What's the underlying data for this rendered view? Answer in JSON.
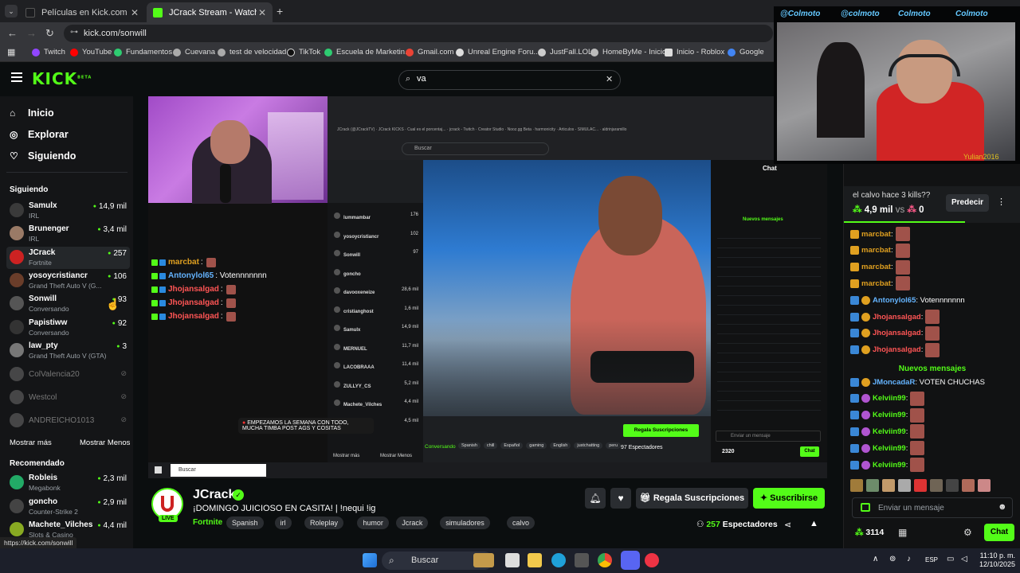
{
  "browser": {
    "tabs": [
      {
        "title": "Películas en Kick.com",
        "active": false
      },
      {
        "title": "JCrack Stream - Watch Live on Kick",
        "active": true
      }
    ],
    "url": "kick.com/sonwill",
    "bookmarks": [
      "Twitch",
      "YouTube",
      "Fundamentos",
      "Cuevana",
      "test de velocidad",
      "TikTok",
      "Escuela de Marketin...",
      "Gmail.com",
      "Unreal Engine Foru...",
      "JustFall.LOL",
      "HomeByMe - Inicio",
      "Inicio - Roblox",
      "Google"
    ],
    "status_url": "https://kick.com/sonwill"
  },
  "header": {
    "logo": "KICK",
    "logo_sup": "BETA",
    "search_value": "va"
  },
  "sidebar": {
    "nav": [
      {
        "label": "Inicio",
        "icon": "home-icon"
      },
      {
        "label": "Explorar",
        "icon": "compass-icon"
      },
      {
        "label": "Siguiendo",
        "icon": "heart-icon"
      }
    ],
    "following_title": "Siguiendo",
    "following": [
      {
        "name": "Samulx",
        "sub": "IRL",
        "viewers": "14,9 mil",
        "color": "#3a3a3a"
      },
      {
        "name": "Brunenger",
        "sub": "IRL",
        "viewers": "3,4 mil",
        "color": "#9a7a66"
      },
      {
        "name": "JCrack",
        "sub": "Fortnite",
        "viewers": "257",
        "color": "#c22",
        "selected": true
      },
      {
        "name": "yosoycristiancr",
        "sub": "Grand Theft Auto V (G...",
        "viewers": "106",
        "color": "#6a3d2a"
      },
      {
        "name": "Sonwill",
        "sub": "Conversando",
        "viewers": "93",
        "color": "#555"
      },
      {
        "name": "Papistiww",
        "sub": "Conversando",
        "viewers": "92",
        "color": "#333"
      },
      {
        "name": "law_pty",
        "sub": "Grand Theft Auto V (GTA)",
        "viewers": "3",
        "color": "#777"
      }
    ],
    "offline": [
      {
        "name": "ColValencia20"
      },
      {
        "name": "Westcol"
      },
      {
        "name": "ANDREICHO1013"
      }
    ],
    "show_more": "Mostrar más",
    "show_less": "Mostrar Menos",
    "recommended_title": "Recomendado",
    "recommended": [
      {
        "name": "Robleis",
        "sub": "Megabonk",
        "viewers": "2,3 mil",
        "color": "#2a6"
      },
      {
        "name": "goncho",
        "sub": "Counter-Strike 2",
        "viewers": "2,9 mil",
        "color": "#444"
      },
      {
        "name": "Machete_Vilches",
        "sub": "Slots & Casino",
        "viewers": "4,4 mil",
        "color": "#8a2"
      }
    ]
  },
  "player": {
    "inner_search": "Buscar",
    "inner_chat_title": "Chat",
    "inner_new_messages": "Nuevos mensajes",
    "inner_viewers": "97 Espectadores",
    "inner_gift": "Regala Suscripciones",
    "inner_chat_placeholder": "Enviar un mensaje",
    "inner_chat_btn": "Chat",
    "inner_points": "2320",
    "inner_tags": [
      "Spanish",
      "chill",
      "Español",
      "gaming",
      "English",
      "justchatting",
      "peru"
    ],
    "inner_category": "Conversando",
    "bubble_text": "EMPEZAMOS LA SEMANA CON TODO, MUCHA TIMBA POST AGS Y COSITAS",
    "overlay_chat": [
      {
        "user": "marcbat",
        "text": ":",
        "color": "#e0a020"
      },
      {
        "user": "Antonylol65",
        "text": ": Votennnnnnn",
        "color": "#64b4ff"
      },
      {
        "user": "Jhojansalgad",
        "text": ":",
        "color": "#ff5555"
      },
      {
        "user": "Jhojansalgad",
        "text": ":",
        "color": "#ff5555"
      },
      {
        "user": "Jhojansalgad",
        "text": ":",
        "color": "#ff5555"
      }
    ],
    "inner_sidebar": [
      {
        "name": "lummambar",
        "v": "176"
      },
      {
        "name": "yosoycristiancr",
        "v": "102"
      },
      {
        "name": "Sonwill",
        "v": "97"
      },
      {
        "name": "goncho",
        "v": ""
      },
      {
        "name": "davooxeneize",
        "v": "28,6 mil"
      },
      {
        "name": "cristianghost",
        "v": "1,6 mil"
      },
      {
        "name": "Samulx",
        "v": "14,9 mil"
      },
      {
        "name": "MERNUEL",
        "v": "11,7 mil"
      },
      {
        "name": "LACOBRAAA",
        "v": "11,4 mil"
      },
      {
        "name": "ZULLYY_CS",
        "v": "5,2 mil"
      },
      {
        "name": "Machete_Vilches",
        "v": "4,4 mil"
      },
      {
        "name": "SoyPan",
        "v": "4,5 mil"
      }
    ],
    "inner_show_more": "Mostrar más",
    "inner_show_less": "Mostrar Menos",
    "inner_taskbar_search": "Buscar"
  },
  "camtop": {
    "labels": [
      "@Colmoto",
      "@colmoto",
      "Colmoto",
      "Colmoto"
    ]
  },
  "stream": {
    "channel": "JCrack",
    "live_label": "LIVE",
    "title": "¡DOMINGO JUICIOSO EN CASITA! | !nequi !ig",
    "category": "Fortnite",
    "tags": [
      "Spanish",
      "irl",
      "Roleplay",
      "humor",
      "Jcrack",
      "simuladores",
      "calvo"
    ],
    "gift_label": "Regala Suscripciones",
    "subscribe_label": "Suscribirse",
    "viewers": "257",
    "viewers_label": "Espectadores"
  },
  "chat": {
    "top_user": "Yulian2016",
    "prediction_question": "el calvo hace 3 kills??",
    "prediction_score_a": "4,9 mil",
    "prediction_vs": "vs",
    "prediction_score_b": "0",
    "predict_button": "Predecir",
    "messages": [
      {
        "user": "marcbat",
        "text": ":",
        "color": "#e0a020",
        "emote": true
      },
      {
        "user": "marcbat",
        "text": ":",
        "color": "#e0a020",
        "emote": true
      },
      {
        "user": "marcbat",
        "text": ":",
        "color": "#e0a020",
        "emote": true
      },
      {
        "user": "marcbat",
        "text": ":",
        "color": "#e0a020",
        "emote": true
      },
      {
        "user": "Antonylol65",
        "text": ": Votennnnnnn",
        "color": "#64b4ff",
        "emote": false
      },
      {
        "user": "Jhojansalgad",
        "text": ":",
        "color": "#ff5555",
        "emote": true
      },
      {
        "user": "Jhojansalgad",
        "text": ":",
        "color": "#ff5555",
        "emote": true
      },
      {
        "user": "Jhojansalgad",
        "text": ":",
        "color": "#ff5555",
        "emote": true
      }
    ],
    "new_messages": "Nuevos mensajes",
    "messages_after": [
      {
        "user": "JMoncadaR",
        "text": ": VOTEN CHUCHAS",
        "color": "#64b4ff",
        "emote": false
      },
      {
        "user": "Kelviin99",
        "text": ":",
        "color": "#53fc18",
        "emote": true
      },
      {
        "user": "Kelviin99",
        "text": ":",
        "color": "#53fc18",
        "emote": true
      },
      {
        "user": "Kelviin99",
        "text": ":",
        "color": "#53fc18",
        "emote": true
      },
      {
        "user": "Kelviin99",
        "text": ":",
        "color": "#53fc18",
        "emote": true
      },
      {
        "user": "Kelviin99",
        "text": ":",
        "color": "#53fc18",
        "emote": true
      }
    ],
    "input_placeholder": "Enviar un mensaje",
    "points": "3114",
    "chat_button": "Chat"
  },
  "taskbar": {
    "search": "Buscar",
    "lang": "ESP",
    "time": "11:10 p. m.",
    "date": "12/10/2025"
  },
  "colors": {
    "accent": "#53fc18",
    "background": "#0b0e0f",
    "sidebar": "#141517"
  }
}
